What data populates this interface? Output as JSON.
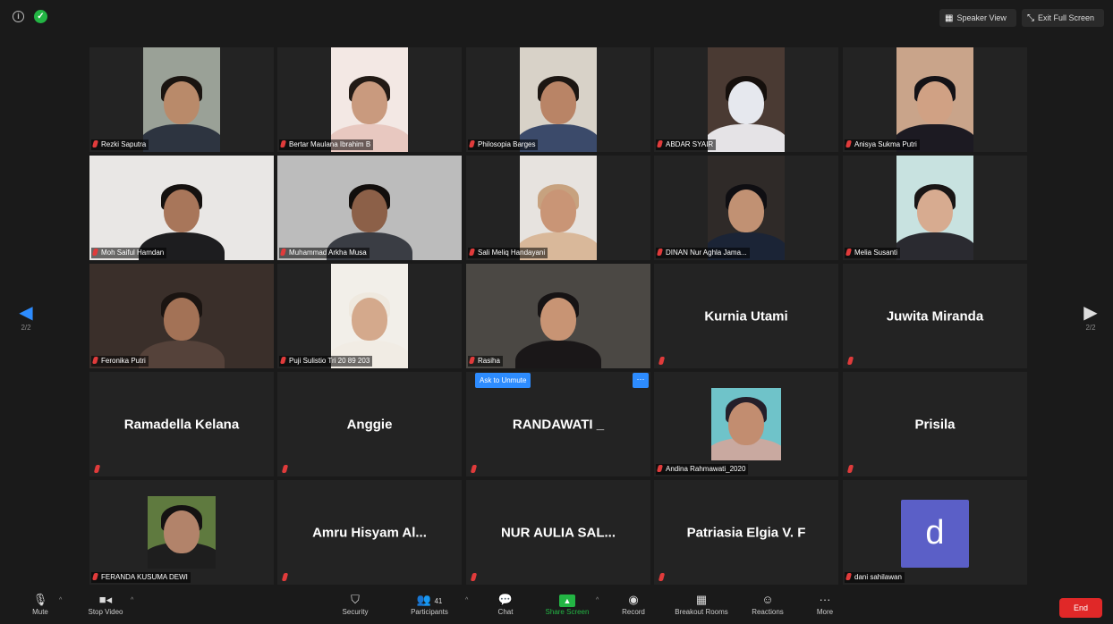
{
  "topbar": {
    "speaker_view": "Speaker View",
    "exit_fullscreen": "Exit Full Screen"
  },
  "nav": {
    "prev_page": "2/2",
    "next_page": "2/2"
  },
  "participants": [
    {
      "name": "Rezki Saputra"
    },
    {
      "name": "Bertar Maulana Ibrahim B"
    },
    {
      "name": "Philosopia Barges"
    },
    {
      "name": "ABDAR SYAIR"
    },
    {
      "name": "Anisya Sukma Putri"
    },
    {
      "name": "Moh Saiful Hamdan"
    },
    {
      "name": "Muhammad Arkha Musa"
    },
    {
      "name": "Sali Meliq Handayani"
    },
    {
      "name": "DINAN Nur Aghla Jama..."
    },
    {
      "name": "Melia Susanti"
    },
    {
      "name": "Feronika Putri"
    },
    {
      "name": "Puji Sulistio Tri 20 89 203"
    },
    {
      "name": "Rasiha"
    },
    {
      "name": "Kurnia Utami"
    },
    {
      "name": "Juwita Miranda"
    },
    {
      "name": "Ramadella Kelana"
    },
    {
      "name": "Anggie"
    },
    {
      "name": "RANDAWATI _"
    },
    {
      "name": "Andina Rahmawati_2020"
    },
    {
      "name": "Prisila"
    },
    {
      "name": "FERANDA KUSUMA DEWI"
    },
    {
      "name": "Amru Hisyam Al..."
    },
    {
      "name": "NUR AULIA SAL..."
    },
    {
      "name": "Patriasia Elgia V. F"
    },
    {
      "name": "dani sahilawan",
      "avatar_letter": "d"
    }
  ],
  "hover": {
    "ask_to_unmute": "Ask to Unmute",
    "more": "···"
  },
  "toolbar": {
    "mute": "Mute",
    "stop_video": "Stop Video",
    "security": "Security",
    "participants": "Participants",
    "participants_count": "41",
    "chat": "Chat",
    "share_screen": "Share Screen",
    "record": "Record",
    "breakout_rooms": "Breakout Rooms",
    "reactions": "Reactions",
    "more": "More",
    "end": "End"
  },
  "colors": {
    "accent": "#2d8cff",
    "share_green": "#23b544",
    "end_red": "#e02828",
    "avatar": "#5b5fc7",
    "tile_bg": "#232323"
  }
}
